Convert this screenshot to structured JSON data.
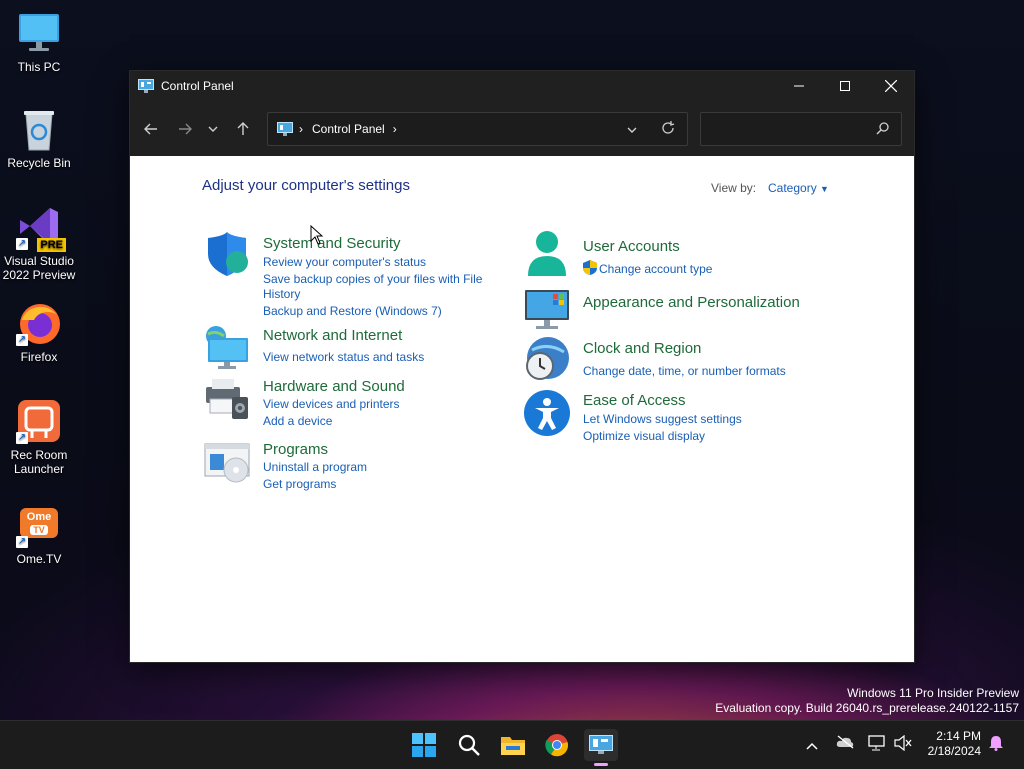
{
  "desktop": {
    "icons": [
      {
        "label_1": "This PC",
        "label_2": ""
      },
      {
        "label_1": "Recycle Bin",
        "label_2": ""
      },
      {
        "label_1": "Visual Studio",
        "label_2": "2022 Preview",
        "badge": "PRE"
      },
      {
        "label_1": "Firefox",
        "label_2": ""
      },
      {
        "label_1": "Rec Room",
        "label_2": "Launcher"
      },
      {
        "label_1": "Ome.TV",
        "label_2": "",
        "logo_top": "Ome",
        "logo_bottom": "TV"
      }
    ]
  },
  "window": {
    "title": "Control Panel",
    "address": {
      "chevron": "›",
      "item": "Control Panel",
      "trail": "›"
    },
    "search": {
      "value": "",
      "placeholder": ""
    }
  },
  "content": {
    "heading": "Adjust your computer's settings",
    "view_by_label": "View by:",
    "view_by_value": "Category",
    "categories": [
      {
        "title": "System and Security",
        "links": [
          "Review your computer's status",
          "Save backup copies of your files with File",
          "History",
          "Backup and Restore (Windows 7)"
        ]
      },
      {
        "title": "Network and Internet",
        "links": [
          "View network status and tasks"
        ]
      },
      {
        "title": "Hardware and Sound",
        "links": [
          "View devices and printers",
          "Add a device"
        ]
      },
      {
        "title": "Programs",
        "links": [
          "Uninstall a program",
          "Get programs"
        ]
      },
      {
        "title": "User Accounts",
        "links": [
          "Change account type"
        ]
      },
      {
        "title": "Appearance and Personalization",
        "links": []
      },
      {
        "title": "Clock and Region",
        "links": [
          "Change date, time, or number formats"
        ]
      },
      {
        "title": "Ease of Access",
        "links": [
          "Let Windows suggest settings",
          "Optimize visual display"
        ]
      }
    ]
  },
  "watermark": {
    "line1": "Windows 11 Pro Insider Preview",
    "line2": "Evaluation copy. Build 26040.rs_prerelease.240122-1157"
  },
  "taskbar": {
    "apps": [
      "start-icon",
      "search-icon",
      "file-explorer-icon",
      "chrome-icon",
      "control-panel-icon"
    ],
    "time": "2:14 PM",
    "date": "2/18/2024"
  },
  "colors": {
    "title_bar": "#202020",
    "category_title": "#1e6b3a",
    "link": "#1a5fb4",
    "heading": "#1e3287"
  }
}
